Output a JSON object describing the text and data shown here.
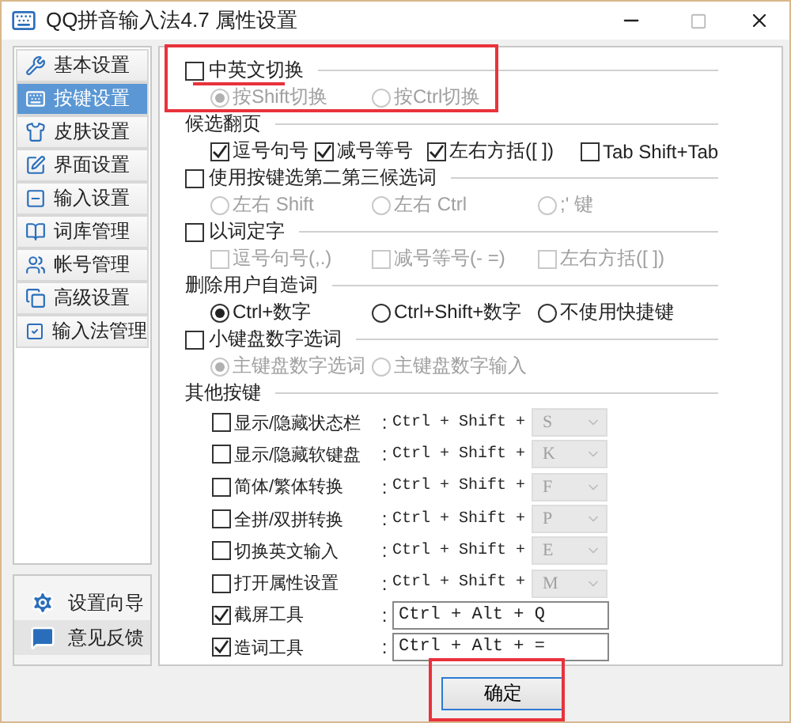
{
  "window": {
    "title": "QQ拼音输入法4.7 属性设置"
  },
  "sidebar": {
    "items": [
      {
        "label": "基本设置",
        "selected": false
      },
      {
        "label": "按键设置",
        "selected": true
      },
      {
        "label": "皮肤设置",
        "selected": false
      },
      {
        "label": "界面设置",
        "selected": false
      },
      {
        "label": "输入设置",
        "selected": false
      },
      {
        "label": "词库管理",
        "selected": false
      },
      {
        "label": "帐号管理",
        "selected": false
      },
      {
        "label": "高级设置",
        "selected": false
      },
      {
        "label": "输入法管理",
        "selected": false
      }
    ],
    "footer": [
      {
        "label": "设置向导",
        "selected": false
      },
      {
        "label": "意见反馈",
        "selected": true
      }
    ]
  },
  "sections": [
    {
      "title": "中英文切换",
      "kind": "checkbox",
      "checked": false,
      "options": [
        {
          "kind": "radio",
          "label": "按Shift切换",
          "selected": true,
          "disabled": true
        },
        {
          "kind": "radio",
          "label": "按Ctrl切换",
          "selected": false,
          "disabled": true
        }
      ]
    },
    {
      "title": "候选翻页",
      "kind": "label",
      "options": [
        {
          "kind": "checkbox",
          "label": "逗号句号",
          "checked": true,
          "disabled": false
        },
        {
          "kind": "checkbox",
          "label": "减号等号",
          "checked": true,
          "disabled": false
        },
        {
          "kind": "checkbox",
          "label": "左右方括([ ])",
          "checked": true,
          "disabled": false
        },
        {
          "kind": "checkbox",
          "label": "Tab Shift+Tab",
          "checked": false,
          "disabled": false
        }
      ]
    },
    {
      "title": "使用按键选第二第三候选词",
      "kind": "checkbox",
      "checked": false,
      "options": [
        {
          "kind": "radio",
          "label": "左右 Shift",
          "selected": false,
          "disabled": true
        },
        {
          "kind": "radio",
          "label": "左右 Ctrl",
          "selected": false,
          "disabled": true
        },
        {
          "kind": "radio",
          "label": ";' 键",
          "selected": false,
          "disabled": true
        }
      ]
    },
    {
      "title": "以词定字",
      "kind": "checkbox",
      "checked": false,
      "options": [
        {
          "kind": "checkbox",
          "label": "逗号句号(,.)",
          "checked": false,
          "disabled": true
        },
        {
          "kind": "checkbox",
          "label": "减号等号(- =)",
          "checked": false,
          "disabled": true
        },
        {
          "kind": "checkbox",
          "label": "左右方括([ ])",
          "checked": false,
          "disabled": true
        }
      ]
    },
    {
      "title": "删除用户自造词",
      "kind": "label",
      "options": [
        {
          "kind": "radio",
          "label": "Ctrl+数字",
          "selected": true,
          "disabled": false
        },
        {
          "kind": "radio",
          "label": "Ctrl+Shift+数字",
          "selected": false,
          "disabled": false
        },
        {
          "kind": "radio",
          "label": "不使用快捷键",
          "selected": false,
          "disabled": false
        }
      ]
    },
    {
      "title": "小键盘数字选词",
      "kind": "checkbox",
      "checked": false,
      "options": [
        {
          "kind": "radio",
          "label": "主键盘数字选词",
          "selected": true,
          "disabled": true
        },
        {
          "kind": "radio",
          "label": "主键盘数字输入",
          "selected": false,
          "disabled": true
        }
      ]
    },
    {
      "title": "其他按键",
      "kind": "label"
    }
  ],
  "hotkeys": [
    {
      "label": "显示/隐藏状态栏",
      "separator": ":",
      "checked": false,
      "kind": "select",
      "prefix": "Ctrl + Shift +",
      "key": "S"
    },
    {
      "label": "显示/隐藏软键盘",
      "separator": ":",
      "checked": false,
      "kind": "select",
      "prefix": "Ctrl + Shift +",
      "key": "K"
    },
    {
      "label": "简体/繁体转换",
      "separator": ":",
      "checked": false,
      "kind": "select",
      "prefix": "Ctrl + Shift +",
      "key": "F"
    },
    {
      "label": "全拼/双拼转换",
      "separator": ":",
      "checked": false,
      "kind": "select",
      "prefix": "Ctrl + Shift +",
      "key": "P"
    },
    {
      "label": "切换英文输入",
      "separator": ":",
      "checked": false,
      "kind": "select",
      "prefix": "Ctrl + Shift +",
      "key": "E"
    },
    {
      "label": "打开属性设置",
      "separator": ":",
      "checked": false,
      "kind": "select",
      "prefix": "Ctrl + Shift +",
      "key": "M"
    },
    {
      "label": "截屏工具",
      "separator": ":",
      "checked": true,
      "kind": "input",
      "value": "Ctrl + Alt + Q"
    },
    {
      "label": "造词工具",
      "separator": ":",
      "checked": true,
      "kind": "input",
      "value": "Ctrl + Alt + ="
    }
  ],
  "buttons": [
    {
      "label": "确定"
    }
  ]
}
